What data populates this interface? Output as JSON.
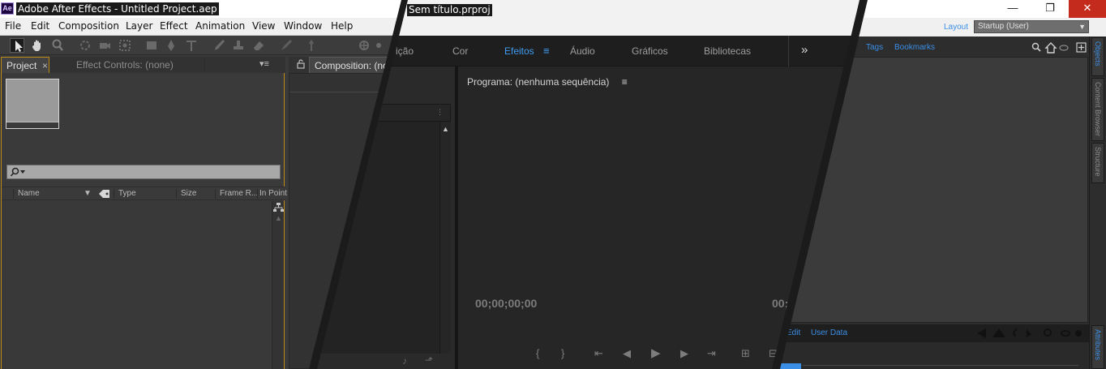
{
  "ae": {
    "logo": "Ae",
    "title": "Adobe After Effects - Untitled Project.aep",
    "menu": [
      "File",
      "Edit",
      "Composition",
      "Layer",
      "Effect",
      "Animation",
      "View",
      "Window",
      "Help"
    ],
    "tabs": {
      "project": "Project",
      "effect_controls": "Effect Controls: (none)",
      "composition": "Composition: (no"
    },
    "columns": [
      "Name",
      "Type",
      "Size",
      "Frame R...",
      "In Point"
    ],
    "accent": "#c08a1a"
  },
  "pr": {
    "title": "Sem título.prproj",
    "workspaces": [
      "ição",
      "Cor",
      "Efeitos",
      "Áudio",
      "Gráficos",
      "Bibliotecas"
    ],
    "more": "»",
    "monitor_title": "Programa: (nenhuma sequência)",
    "timecode_left": "00;00;00;00",
    "timecode_right": "00;",
    "accent": "#3f9cf0"
  },
  "br": {
    "window_buttons": {
      "minimize": "—",
      "maximize": "❐",
      "close": "✕"
    },
    "layout_label": "Layout",
    "layout_value": "Startup (User)",
    "tabs": [
      "Tags",
      "Bookmarks"
    ],
    "bottom_tabs": [
      "Edit",
      "User Data"
    ],
    "rail_tabs": [
      "Objects",
      "Content Browser",
      "Structure",
      "Attributes"
    ],
    "accent": "#3a8ee6"
  }
}
